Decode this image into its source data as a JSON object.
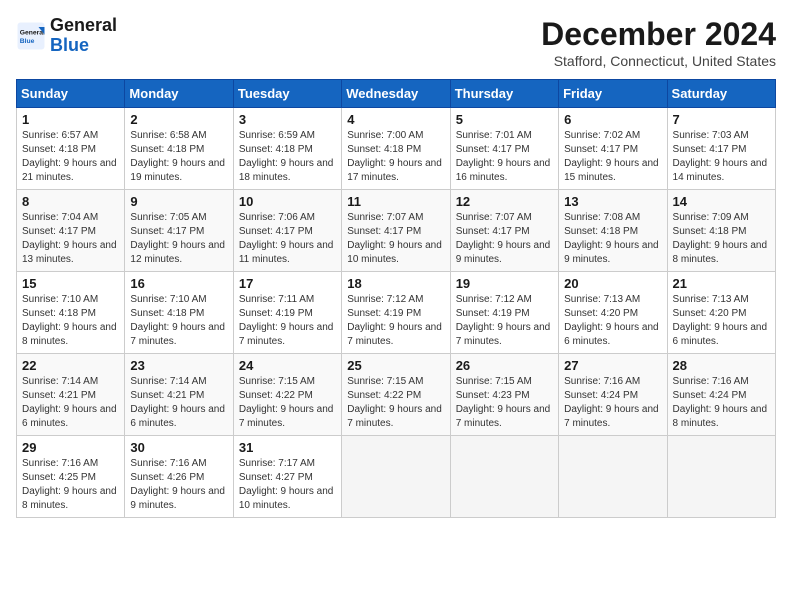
{
  "header": {
    "logo_line1": "General",
    "logo_line2": "Blue",
    "title": "December 2024",
    "subtitle": "Stafford, Connecticut, United States"
  },
  "weekdays": [
    "Sunday",
    "Monday",
    "Tuesday",
    "Wednesday",
    "Thursday",
    "Friday",
    "Saturday"
  ],
  "weeks": [
    [
      {
        "day": "1",
        "sunrise": "6:57 AM",
        "sunset": "4:18 PM",
        "daylight": "9 hours and 21 minutes."
      },
      {
        "day": "2",
        "sunrise": "6:58 AM",
        "sunset": "4:18 PM",
        "daylight": "9 hours and 19 minutes."
      },
      {
        "day": "3",
        "sunrise": "6:59 AM",
        "sunset": "4:18 PM",
        "daylight": "9 hours and 18 minutes."
      },
      {
        "day": "4",
        "sunrise": "7:00 AM",
        "sunset": "4:18 PM",
        "daylight": "9 hours and 17 minutes."
      },
      {
        "day": "5",
        "sunrise": "7:01 AM",
        "sunset": "4:17 PM",
        "daylight": "9 hours and 16 minutes."
      },
      {
        "day": "6",
        "sunrise": "7:02 AM",
        "sunset": "4:17 PM",
        "daylight": "9 hours and 15 minutes."
      },
      {
        "day": "7",
        "sunrise": "7:03 AM",
        "sunset": "4:17 PM",
        "daylight": "9 hours and 14 minutes."
      }
    ],
    [
      {
        "day": "8",
        "sunrise": "7:04 AM",
        "sunset": "4:17 PM",
        "daylight": "9 hours and 13 minutes."
      },
      {
        "day": "9",
        "sunrise": "7:05 AM",
        "sunset": "4:17 PM",
        "daylight": "9 hours and 12 minutes."
      },
      {
        "day": "10",
        "sunrise": "7:06 AM",
        "sunset": "4:17 PM",
        "daylight": "9 hours and 11 minutes."
      },
      {
        "day": "11",
        "sunrise": "7:07 AM",
        "sunset": "4:17 PM",
        "daylight": "9 hours and 10 minutes."
      },
      {
        "day": "12",
        "sunrise": "7:07 AM",
        "sunset": "4:17 PM",
        "daylight": "9 hours and 9 minutes."
      },
      {
        "day": "13",
        "sunrise": "7:08 AM",
        "sunset": "4:18 PM",
        "daylight": "9 hours and 9 minutes."
      },
      {
        "day": "14",
        "sunrise": "7:09 AM",
        "sunset": "4:18 PM",
        "daylight": "9 hours and 8 minutes."
      }
    ],
    [
      {
        "day": "15",
        "sunrise": "7:10 AM",
        "sunset": "4:18 PM",
        "daylight": "9 hours and 8 minutes."
      },
      {
        "day": "16",
        "sunrise": "7:10 AM",
        "sunset": "4:18 PM",
        "daylight": "9 hours and 7 minutes."
      },
      {
        "day": "17",
        "sunrise": "7:11 AM",
        "sunset": "4:19 PM",
        "daylight": "9 hours and 7 minutes."
      },
      {
        "day": "18",
        "sunrise": "7:12 AM",
        "sunset": "4:19 PM",
        "daylight": "9 hours and 7 minutes."
      },
      {
        "day": "19",
        "sunrise": "7:12 AM",
        "sunset": "4:19 PM",
        "daylight": "9 hours and 7 minutes."
      },
      {
        "day": "20",
        "sunrise": "7:13 AM",
        "sunset": "4:20 PM",
        "daylight": "9 hours and 6 minutes."
      },
      {
        "day": "21",
        "sunrise": "7:13 AM",
        "sunset": "4:20 PM",
        "daylight": "9 hours and 6 minutes."
      }
    ],
    [
      {
        "day": "22",
        "sunrise": "7:14 AM",
        "sunset": "4:21 PM",
        "daylight": "9 hours and 6 minutes."
      },
      {
        "day": "23",
        "sunrise": "7:14 AM",
        "sunset": "4:21 PM",
        "daylight": "9 hours and 6 minutes."
      },
      {
        "day": "24",
        "sunrise": "7:15 AM",
        "sunset": "4:22 PM",
        "daylight": "9 hours and 7 minutes."
      },
      {
        "day": "25",
        "sunrise": "7:15 AM",
        "sunset": "4:22 PM",
        "daylight": "9 hours and 7 minutes."
      },
      {
        "day": "26",
        "sunrise": "7:15 AM",
        "sunset": "4:23 PM",
        "daylight": "9 hours and 7 minutes."
      },
      {
        "day": "27",
        "sunrise": "7:16 AM",
        "sunset": "4:24 PM",
        "daylight": "9 hours and 7 minutes."
      },
      {
        "day": "28",
        "sunrise": "7:16 AM",
        "sunset": "4:24 PM",
        "daylight": "9 hours and 8 minutes."
      }
    ],
    [
      {
        "day": "29",
        "sunrise": "7:16 AM",
        "sunset": "4:25 PM",
        "daylight": "9 hours and 8 minutes."
      },
      {
        "day": "30",
        "sunrise": "7:16 AM",
        "sunset": "4:26 PM",
        "daylight": "9 hours and 9 minutes."
      },
      {
        "day": "31",
        "sunrise": "7:17 AM",
        "sunset": "4:27 PM",
        "daylight": "9 hours and 10 minutes."
      },
      null,
      null,
      null,
      null
    ]
  ]
}
